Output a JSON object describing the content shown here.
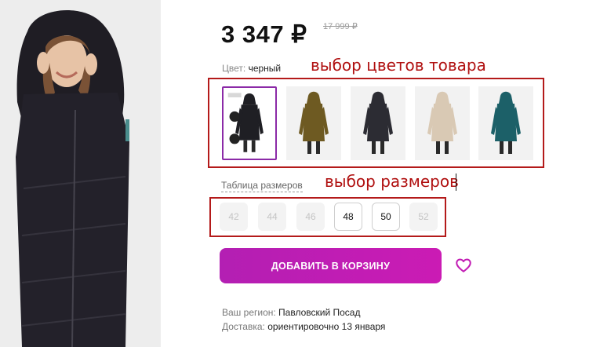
{
  "product": {
    "price": "3 347 ₽",
    "old_price": "17 999 ₽"
  },
  "color": {
    "label": "Цвет:",
    "value": "черный",
    "thumbnails": [
      {
        "name": "Color option 1 (selected, black)",
        "coat_color": "#1f1f24",
        "selected": true
      },
      {
        "name": "Color option 2 (olive)",
        "coat_color": "#6e5a22",
        "selected": false
      },
      {
        "name": "Color option 3 (dark gray)",
        "coat_color": "#2c2c33",
        "selected": false
      },
      {
        "name": "Color option 4 (beige)",
        "coat_color": "#d9c9b4",
        "selected": false
      },
      {
        "name": "Color option 5 (teal)",
        "coat_color": "#1c6068",
        "selected": false
      }
    ]
  },
  "annotations": {
    "colors": "выбор цветов товара",
    "sizes": "выбор размеров"
  },
  "sizes": {
    "table_link": "Таблица размеров",
    "items": [
      {
        "label": "42",
        "available": false
      },
      {
        "label": "44",
        "available": false
      },
      {
        "label": "46",
        "available": false
      },
      {
        "label": "48",
        "available": true
      },
      {
        "label": "50",
        "available": true
      },
      {
        "label": "52",
        "available": false
      }
    ]
  },
  "cart": {
    "button_label": "ДОБАВИТЬ В КОРЗИНУ"
  },
  "favorite_icon": "heart-outline-icon",
  "delivery": {
    "region_label": "Ваш регион:",
    "region_value": "Павловский Посад",
    "delivery_label": "Доставка:",
    "delivery_value": "ориентировочно 13 января"
  },
  "colors": {
    "accent": "#c21db4",
    "selected_border": "#8b2aa7",
    "annotation": "#b41a1a"
  }
}
